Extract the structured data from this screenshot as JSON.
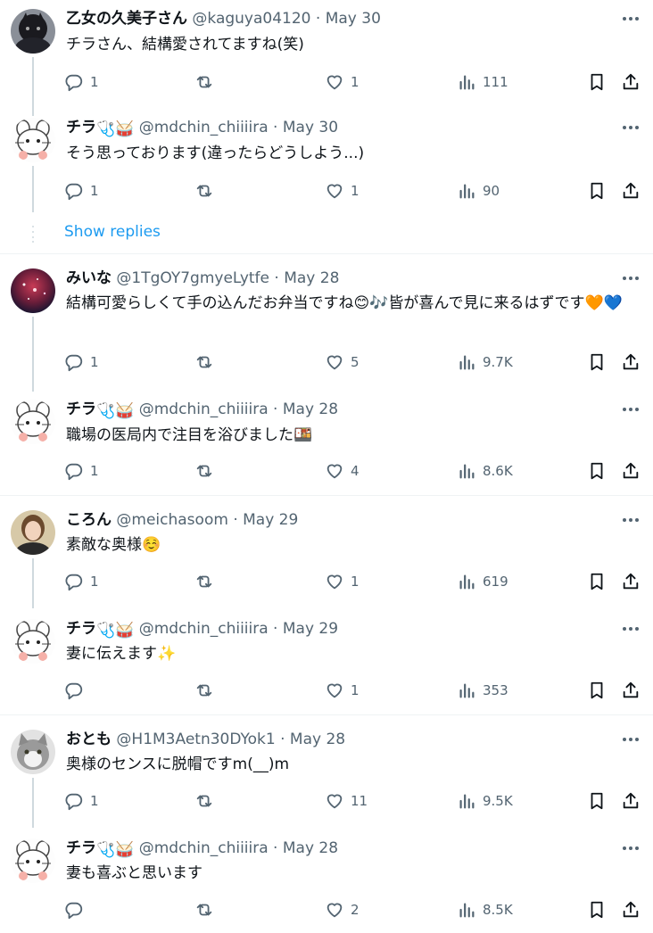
{
  "actions_labels": {
    "reply": "Reply",
    "repost": "Repost",
    "like": "Like",
    "views": "Views",
    "bookmark": "Bookmark",
    "share": "Share"
  },
  "show_replies": "Show replies",
  "tweets": [
    {
      "name": "乙女の久美子さん",
      "handle": "@kaguya04120",
      "sep": "·",
      "date": "May 30",
      "text": "チラさん、結構愛されてますね(笑)",
      "replies": "1",
      "reposts": "",
      "likes": "1",
      "views": "111",
      "avatar": "dark-dog-avatar"
    },
    {
      "name": "チラ",
      "name_suffix": "🩺🥁",
      "handle": "@mdchin_chiiiira",
      "sep": "·",
      "date": "May 30",
      "text": "そう思っております(違ったらどうしよう...)",
      "replies": "1",
      "reposts": "",
      "likes": "1",
      "views": "90",
      "avatar": "chinchilla-avatar"
    },
    {
      "name": "みいな",
      "handle": "@1TgOY7gmyeLytfe",
      "sep": "·",
      "date": "May 28",
      "text": "結構可愛らしくて手の込んだお弁当ですね😊🎶皆が喜んで見に来るはずです🧡💙",
      "replies": "1",
      "reposts": "",
      "likes": "5",
      "views": "9.7K",
      "avatar": "galaxy-avatar"
    },
    {
      "name": "チラ",
      "name_suffix": "🩺🥁",
      "handle": "@mdchin_chiiiira",
      "sep": "·",
      "date": "May 28",
      "text": "職場の医局内で注目を浴びました🍱",
      "replies": "1",
      "reposts": "",
      "likes": "4",
      "views": "8.6K",
      "avatar": "chinchilla-avatar"
    },
    {
      "name": "ころん",
      "handle": "@meichasoom",
      "sep": "·",
      "date": "May 29",
      "text": "素敵な奥様☺️",
      "replies": "1",
      "reposts": "",
      "likes": "1",
      "views": "619",
      "avatar": "woman-photo-avatar"
    },
    {
      "name": "チラ",
      "name_suffix": "🩺🥁",
      "handle": "@mdchin_chiiiira",
      "sep": "·",
      "date": "May 29",
      "text": "妻に伝えます✨",
      "replies": "",
      "reposts": "",
      "likes": "1",
      "views": "353",
      "avatar": "chinchilla-avatar"
    },
    {
      "name": "おとも",
      "handle": "@H1M3Aetn30DYok1",
      "sep": "·",
      "date": "May 28",
      "text": "奥様のセンスに脱帽ですm(__)m",
      "replies": "1",
      "reposts": "",
      "likes": "11",
      "views": "9.5K",
      "avatar": "cat-avatar"
    },
    {
      "name": "チラ",
      "name_suffix": "🩺🥁",
      "handle": "@mdchin_chiiiira",
      "sep": "·",
      "date": "May 28",
      "text": "妻も喜ぶと思います",
      "replies": "",
      "reposts": "",
      "likes": "2",
      "views": "8.5K",
      "avatar": "chinchilla-avatar"
    }
  ]
}
